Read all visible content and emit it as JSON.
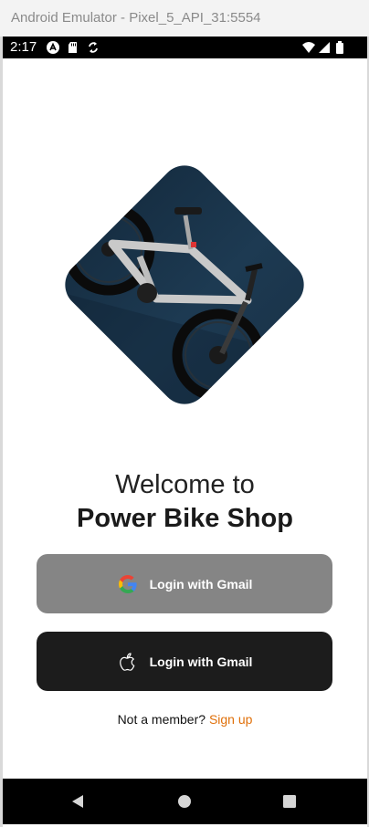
{
  "window": {
    "title": "Android Emulator - Pixel_5_API_31:5554"
  },
  "status_bar": {
    "time": "2:17",
    "icons": [
      "app-notification-icon",
      "sd-card-icon",
      "sync-icon",
      "wifi-icon",
      "signal-icon",
      "battery-icon"
    ]
  },
  "hero": {
    "image": "electric-bike-photo",
    "background": "#1c3347"
  },
  "welcome": {
    "line1": "Welcome to",
    "line2": "Power Bike Shop"
  },
  "buttons": {
    "google": {
      "label": "Login with Gmail",
      "icon": "google-icon",
      "color": "#858585"
    },
    "apple": {
      "label": "Login with Gmail",
      "icon": "apple-icon",
      "color": "#1c1c1c"
    }
  },
  "signup": {
    "prompt": "Not a member?",
    "link": "Sign up",
    "link_color": "#e0700a"
  },
  "nav_bar": {
    "icons": [
      "back-icon",
      "home-icon",
      "recents-icon"
    ]
  }
}
